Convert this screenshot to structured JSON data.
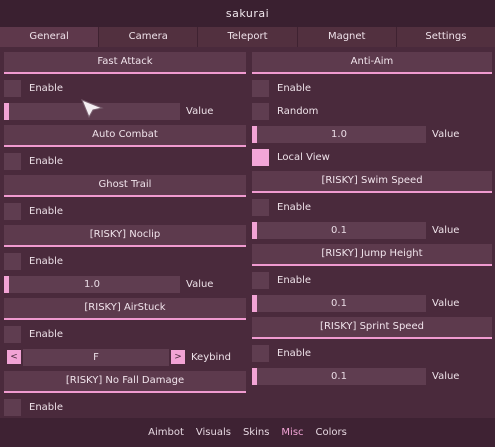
{
  "window": {
    "title": "sakurai"
  },
  "tabs": [
    {
      "label": "General",
      "active": true
    },
    {
      "label": "Camera",
      "active": false
    },
    {
      "label": "Teleport",
      "active": false
    },
    {
      "label": "Magnet",
      "active": false
    },
    {
      "label": "Settings",
      "active": false
    }
  ],
  "left": {
    "fast_attack": {
      "header": "Fast Attack",
      "enable": "Enable",
      "value_label": "Value"
    },
    "auto_combat": {
      "header": "Auto Combat",
      "enable": "Enable"
    },
    "ghost_trail": {
      "header": "Ghost Trail",
      "enable": "Enable"
    },
    "noclip": {
      "header": "[RISKY] Noclip",
      "enable": "Enable",
      "value": "1.0",
      "value_label": "Value"
    },
    "airstuck": {
      "header": "[RISKY] AirStuck",
      "enable": "Enable",
      "key": "F",
      "prev": "<",
      "next": ">",
      "keybind_label": "Keybind"
    },
    "no_fall": {
      "header": "[RISKY] No Fall Damage",
      "enable": "Enable"
    }
  },
  "right": {
    "anti_aim": {
      "header": "Anti-Aim",
      "enable": "Enable",
      "random": "Random",
      "value": "1.0",
      "value_label": "Value",
      "local_view": "Local View"
    },
    "swim": {
      "header": "[RISKY] Swim Speed",
      "enable": "Enable",
      "value": "0.1",
      "value_label": "Value"
    },
    "jump": {
      "header": "[RISKY] Jump Height",
      "enable": "Enable",
      "value": "0.1",
      "value_label": "Value"
    },
    "sprint": {
      "header": "[RISKY] Sprint Speed",
      "enable": "Enable",
      "value": "0.1",
      "value_label": "Value"
    }
  },
  "bottom_tabs": [
    {
      "label": "Aimbot",
      "active": false
    },
    {
      "label": "Visuals",
      "active": false
    },
    {
      "label": "Skins",
      "active": false
    },
    {
      "label": "Misc",
      "active": true
    },
    {
      "label": "Colors",
      "active": false
    }
  ],
  "colors": {
    "accent": "#f2a3d5",
    "background": "#4a2a3c",
    "control": "#5f3d50"
  }
}
